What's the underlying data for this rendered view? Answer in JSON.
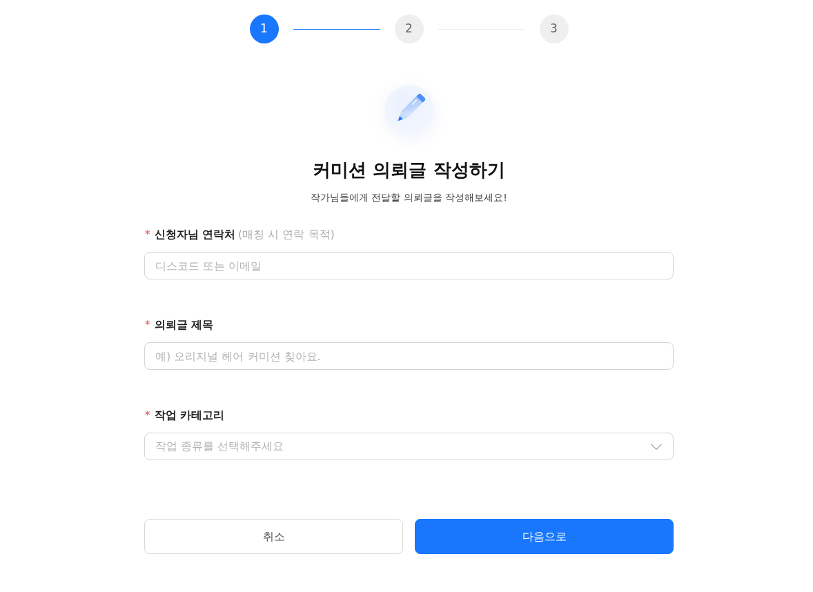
{
  "stepper": {
    "steps": [
      {
        "label": "1",
        "selected": true
      },
      {
        "label": "2",
        "selected": false
      },
      {
        "label": "3",
        "selected": false
      }
    ],
    "connectors": [
      {
        "filled": true
      },
      {
        "filled": false
      }
    ]
  },
  "header": {
    "title": "커미션 의뢰글 작성하기",
    "subtitle": "작가님들에게 전달할 의뢰글을 작성해보세요!"
  },
  "fields": [
    {
      "kind": "text",
      "required_mark": "*",
      "label": "신청자님 연락처",
      "hint": "(매칭 시 연락 목적)",
      "placeholder": "디스코드 또는 이메일"
    },
    {
      "kind": "text",
      "required_mark": "*",
      "label": "의뢰글 제목",
      "placeholder": "예) 오리지널 헤어 커미션 찾아요."
    },
    {
      "kind": "select",
      "required_mark": "*",
      "label": "작업 카테고리",
      "placeholder": "작업 종류를 선택해주세요"
    }
  ],
  "buttons": [
    {
      "label": "취소",
      "kind": "secondary"
    },
    {
      "label": "다음으로",
      "kind": "primary"
    }
  ]
}
